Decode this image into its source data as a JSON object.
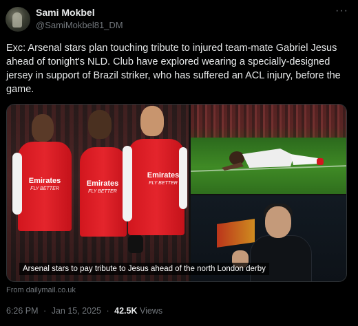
{
  "author": {
    "name": "Sami Mokbel",
    "handle": "@SamiMokbel81_DM"
  },
  "more_menu_icon": "more-horizontal-icon",
  "tweet_text": "Exc: Arsenal stars plan touching tribute to injured team-mate Gabriel Jesus ahead of tonight's NLD. Club have explored wearing a specially-designed jersey in support of Brazil striker, who has suffered an ACL injury, before the game.",
  "media": {
    "shirt_sponsor": "Emirates",
    "shirt_tagline": "FLY BETTER",
    "caption": "Arsenal stars to pay tribute to Jesus ahead of the north London derby"
  },
  "link_source": "From dailymail.co.uk",
  "meta": {
    "time": "6:26 PM",
    "separator": "·",
    "date": "Jan 15, 2025",
    "views_count": "42.5K",
    "views_label": "Views"
  },
  "colors": {
    "background": "#000000",
    "text_primary": "#e7e9ea",
    "text_secondary": "#71767b",
    "border": "#2f3336",
    "shirt_red": "#d2161e"
  }
}
